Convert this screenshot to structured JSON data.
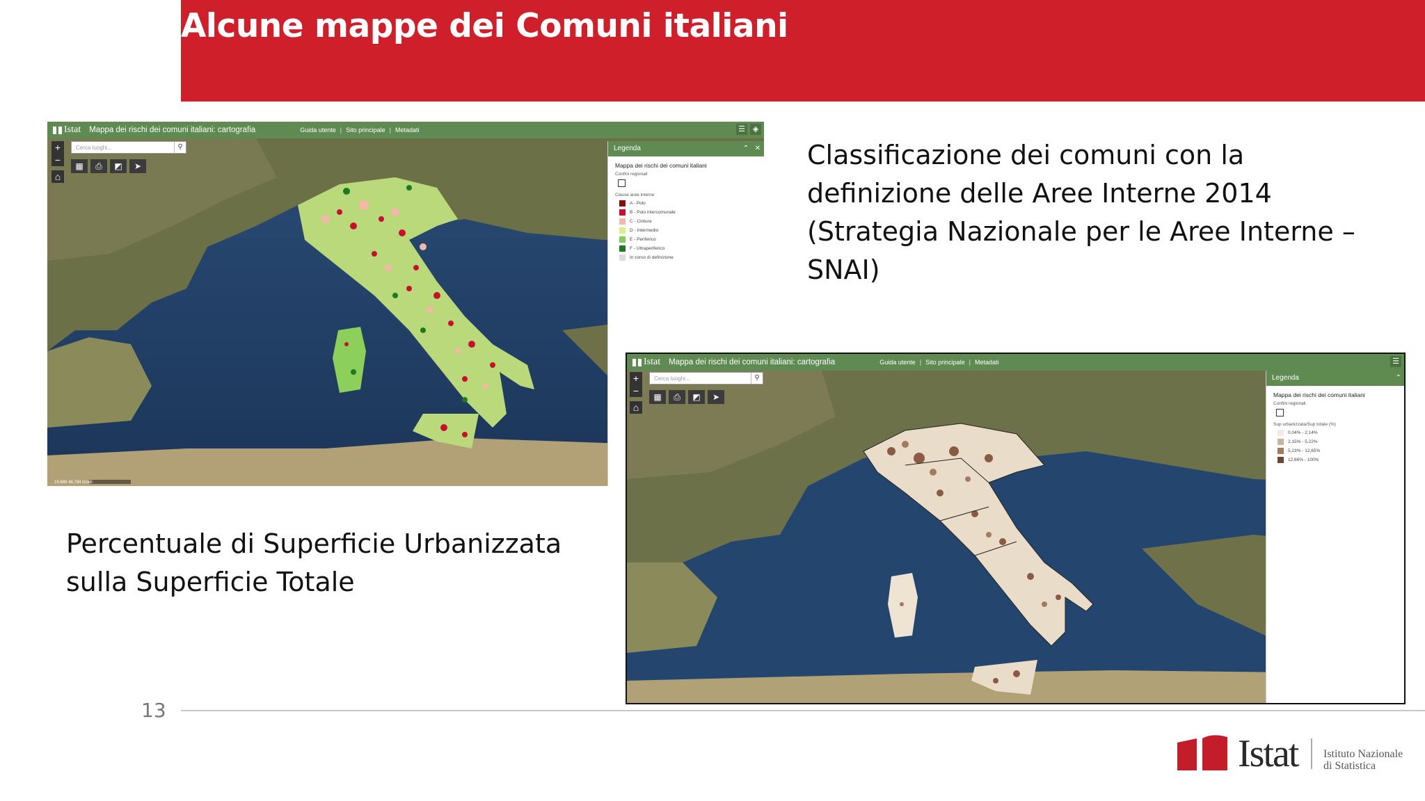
{
  "header": {
    "title": "Alcune mappe dei Comuni italiani"
  },
  "captions": {
    "top_right": "Classificazione dei comuni con la definizione delle Aree Interne 2014 (Strategia Nazionale per le Aree Interne – SNAI)",
    "bottom_left": "Percentuale di Superficie Urbanizzata sulla Superficie Totale"
  },
  "map1": {
    "brand": "Istat",
    "app_title": "Mappa dei rischi dei comuni italiani: cartografia",
    "nav": [
      "Guida utente",
      "Sito principale",
      "Metadati"
    ],
    "search_placeholder": "Cerca luoghi...",
    "legend": {
      "header": "Legenda",
      "title": "Mappa dei rischi dei comuni italiani",
      "borders_label": "Confini regionali",
      "class_title": "Classe aree interne",
      "classes": [
        {
          "label": "A - Polo",
          "color": "#8b0a0a"
        },
        {
          "label": "B - Polo intercomunale",
          "color": "#c8102e"
        },
        {
          "label": "C - Cintura",
          "color": "#f2b8a8"
        },
        {
          "label": "D - Intermedio",
          "color": "#d9ef8b"
        },
        {
          "label": "E - Periferico",
          "color": "#7ccf5a"
        },
        {
          "label": "F - Ultraperiferico",
          "color": "#1f7a1f"
        },
        {
          "label": "In corso di definizione",
          "color": "#dddddd"
        }
      ]
    },
    "scale": "19,689 46,784 Gradi"
  },
  "map2": {
    "brand": "Istat",
    "app_title": "Mappa dei rischi dei comuni italiani: cartografia",
    "nav": [
      "Guida utente",
      "Sito principale",
      "Metadati"
    ],
    "search_placeholder": "Cerca luoghi...",
    "legend": {
      "header": "Legenda",
      "title": "Mappa dei rischi dei comuni italiani",
      "borders_label": "Confini regionali",
      "class_title": "Sup urbanizzata/Sup totale (%)",
      "classes": [
        {
          "label": "0,04% - 2,14%",
          "color": "#f1ebe1"
        },
        {
          "label": "2,15% - 5,22%",
          "color": "#c9b39d"
        },
        {
          "label": "5,23% - 12,65%",
          "color": "#a07c62"
        },
        {
          "label": "12,66% - 100%",
          "color": "#6b4633"
        }
      ]
    }
  },
  "footer": {
    "page_number": "13",
    "logo_word": "Istat",
    "logo_subtitle_line1": "Istituto Nazionale",
    "logo_subtitle_line2": "di Statistica"
  },
  "colors": {
    "header_red": "#cf1f2b",
    "map_bar_green": "#5f8a52"
  }
}
